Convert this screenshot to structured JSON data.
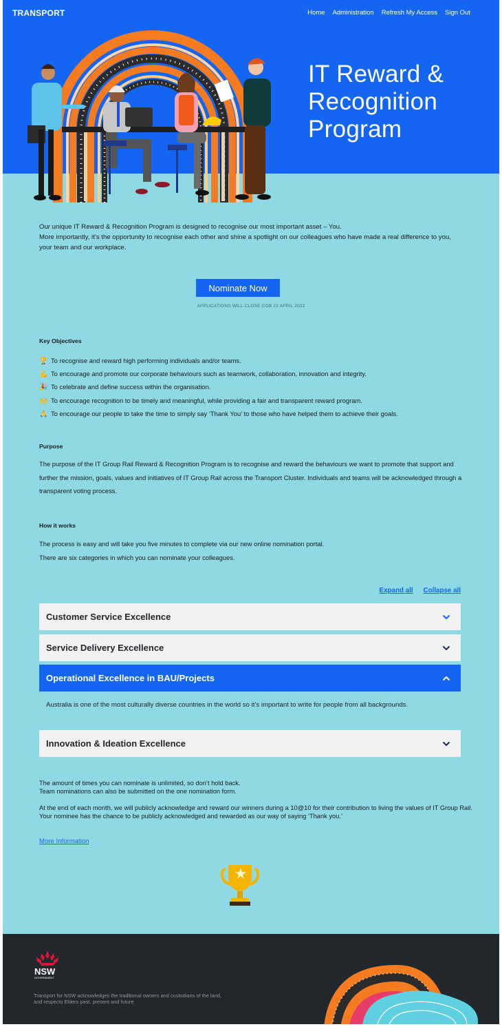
{
  "header": {
    "brand": "TRANSPORT",
    "nav": [
      "Home",
      "Administration",
      "Refresh My Access",
      "Sign Out"
    ]
  },
  "hero": {
    "title_lines": [
      "IT Reward &",
      "Recognition",
      "Program"
    ]
  },
  "intro": {
    "line1": "Our unique IT Reward & Recognition Program is designed to recognise our most important asset – You.",
    "line2": "More importantly, it’s the opportunity to recognise each other and shine a spotlight on our colleagues who have made a real difference to you, your team and our workplace."
  },
  "cta": {
    "nominate_label": "Nominate Now",
    "closing_text": "APPLICATIONS WILL CLOSE COB 22 APRIL 2022"
  },
  "objectives": {
    "heading": "Key Objectives",
    "items": [
      {
        "emoji": "🏆",
        "text": "To recognise and reward high performing individuals and/or teams."
      },
      {
        "emoji": "💪",
        "text": "To encourage and promote our corporate behaviours such as teamwork, collaboration, innovation and integrity."
      },
      {
        "emoji": "🎉",
        "text": "To celebrate and define success within the organisation."
      },
      {
        "emoji": "🙌",
        "text": "To encourage recognition to be timely and meaningful, while providing a fair and transparent reward program."
      },
      {
        "emoji": "🙏",
        "text": "To encourage our people to take the time to simply say ‘Thank You’ to those who have helped them to achieve their goals."
      }
    ]
  },
  "purpose": {
    "heading": "Purpose",
    "text": "The purpose of the IT Group Rail Reward & Recognition Program is to recognise and reward the behaviours we want to promote that support and further the mission, goals, values and initiatives of IT Group Rail across the Transport Cluster. Individuals and teams will be acknowledged through a transparent voting process."
  },
  "how": {
    "heading": "How it works",
    "line1": "The process is easy and will take you five minutes to complete via our new online nomination portal.",
    "line2": "There are six categories in which you can nominate your colleagues."
  },
  "accordion": {
    "expand_all": "Expand all",
    "collapse_all": "Collapse all",
    "items": [
      {
        "title": "Customer Service Excellence",
        "open": false
      },
      {
        "title": "Service Delivery Excellence",
        "open": false
      },
      {
        "title": "Operational Excellence in BAU/Projects",
        "open": true,
        "body": "Australia is one of the most culturally diverse countries in the world so it’s important to write for people from all backgrounds."
      },
      {
        "title": "Innovation & Ideation Excellence",
        "open": false
      }
    ]
  },
  "notes": {
    "unlimited": "The amount of times you can nominate is unlimited, so don’t hold back.",
    "team": "Team nominations can also be submitted on the one nomination form.",
    "monthly": "At the end of each month, we will publicly acknowledge and reward our winners during a 10@10 for their contribution to living the values of IT Group Rail. Your nominee has the chance to be publicly acknowledged and rewarded as our way of saying ‘Thank you.’"
  },
  "more_info": "More Information",
  "footer": {
    "logo_text": "NSW",
    "logo_sub": "GOVERNMENT",
    "acknowledgement_line1": "Transport for NSW acknowledges the traditional owners and custodians of the land,",
    "acknowledgement_line2": "and respects Elders past, present and future"
  },
  "colors": {
    "primary_blue": "#1466f2",
    "teal_background": "#8fd9e5",
    "accordion_grey": "#f2f2f2",
    "footer_dark": "#22272b",
    "waratah_red": "#d7153a"
  }
}
